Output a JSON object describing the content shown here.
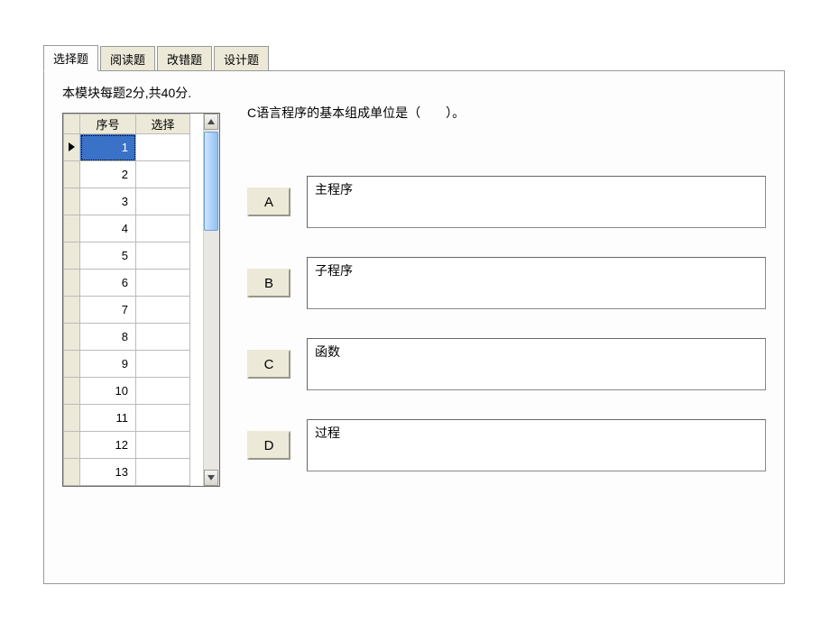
{
  "tabs": [
    {
      "label": "选择题",
      "active": true
    },
    {
      "label": "阅读题",
      "active": false
    },
    {
      "label": "改错题",
      "active": false
    },
    {
      "label": "设计题",
      "active": false
    }
  ],
  "module_info": "本模块每题2分,共40分.",
  "grid": {
    "headers": {
      "num": "序号",
      "sel": "选择"
    },
    "rows": [
      {
        "num": "1",
        "sel": "",
        "current": true
      },
      {
        "num": "2",
        "sel": "",
        "current": false
      },
      {
        "num": "3",
        "sel": "",
        "current": false
      },
      {
        "num": "4",
        "sel": "",
        "current": false
      },
      {
        "num": "5",
        "sel": "",
        "current": false
      },
      {
        "num": "6",
        "sel": "",
        "current": false
      },
      {
        "num": "7",
        "sel": "",
        "current": false
      },
      {
        "num": "8",
        "sel": "",
        "current": false
      },
      {
        "num": "9",
        "sel": "",
        "current": false
      },
      {
        "num": "10",
        "sel": "",
        "current": false
      },
      {
        "num": "11",
        "sel": "",
        "current": false
      },
      {
        "num": "12",
        "sel": "",
        "current": false
      },
      {
        "num": "13",
        "sel": "",
        "current": false
      }
    ]
  },
  "question": "C语言程序的基本组成单位是（　　）。",
  "options": [
    {
      "key": "A",
      "text": "主程序"
    },
    {
      "key": "B",
      "text": "子程序"
    },
    {
      "key": "C",
      "text": "函数"
    },
    {
      "key": "D",
      "text": "过程"
    }
  ]
}
